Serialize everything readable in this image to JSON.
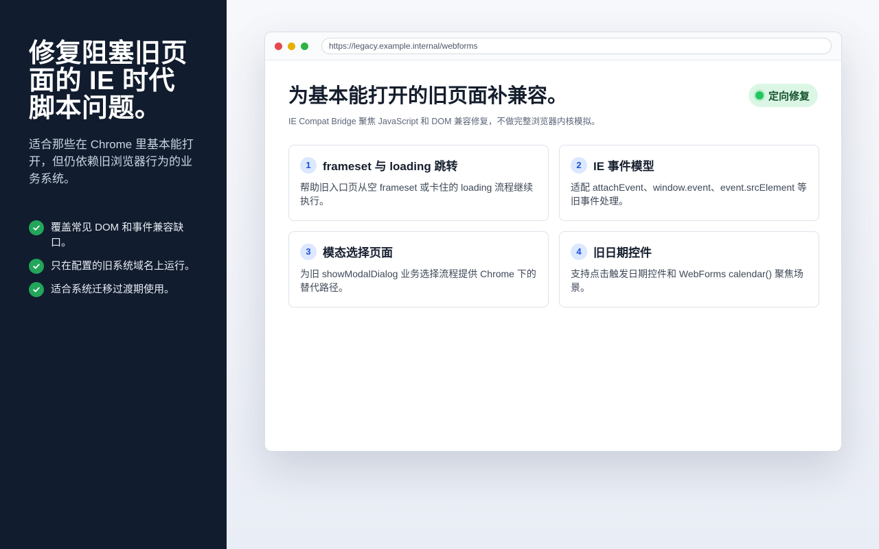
{
  "sidebar": {
    "title": "修复阻塞旧页面的 IE 时代脚本问题。",
    "subtitle": "适合那些在 Chrome 里基本能打开，但仍依赖旧浏览器行为的业务系统。",
    "features": [
      {
        "text": "覆盖常见 DOM 和事件兼容缺口。",
        "icon": "check-icon"
      },
      {
        "text": "只在配置的旧系统域名上运行。",
        "icon": "check-icon"
      },
      {
        "text": "适合系统迁移过渡期使用。",
        "icon": "check-icon"
      }
    ]
  },
  "browser": {
    "url": "https://legacy.example.internal/webforms"
  },
  "page": {
    "title": "为基本能打开的旧页面补兼容。",
    "subtitle": "IE Compat Bridge 聚焦 JavaScript 和 DOM 兼容修复，不做完整浏览器内核模拟。",
    "badge": "定向修复"
  },
  "cards": [
    {
      "num": "1",
      "title": "frameset 与 loading 跳转",
      "desc": "帮助旧入口页从空 frameset 或卡住的 loading 流程继续执行。"
    },
    {
      "num": "2",
      "title": "IE 事件模型",
      "desc": "适配 attachEvent、window.event、event.srcElement 等旧事件处理。"
    },
    {
      "num": "3",
      "title": "模态选择页面",
      "desc": "为旧 showModalDialog 业务选择流程提供 Chrome 下的替代路径。"
    },
    {
      "num": "4",
      "title": "旧日期控件",
      "desc": "支持点击触发日期控件和 WebForms calendar() 聚焦场景。"
    }
  ],
  "colors": {
    "sidebar_bg": "#111c2e",
    "check_green": "#23a55a",
    "badge_bg": "#dcf6e6",
    "number_blue": "#1d4ed8"
  }
}
